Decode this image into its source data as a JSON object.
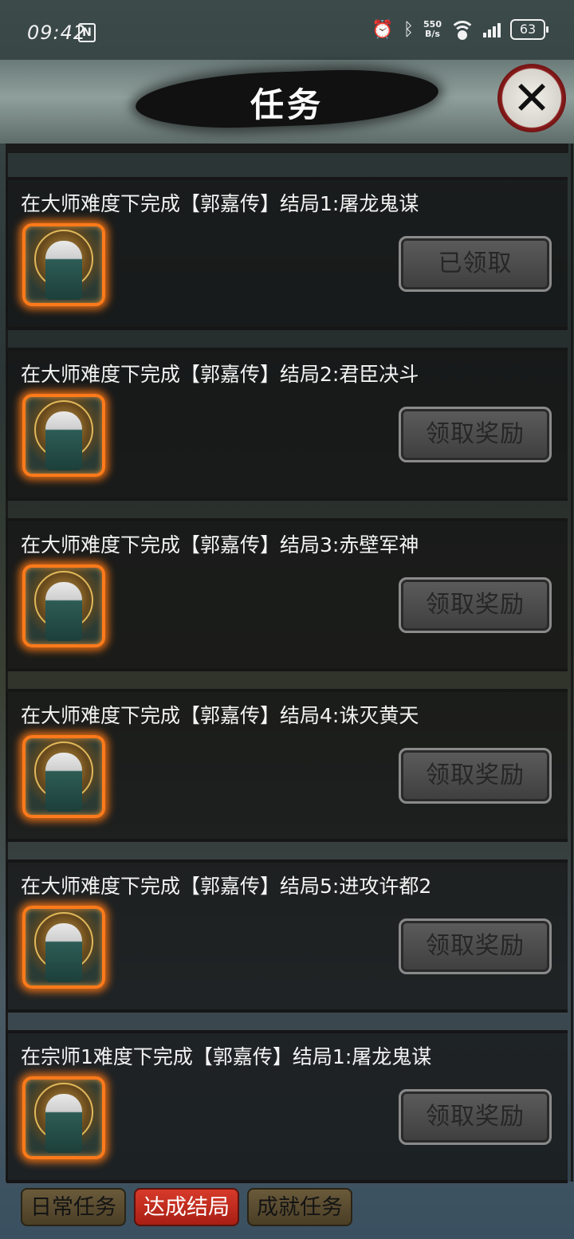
{
  "status_bar": {
    "time": "09:42",
    "nfc": "N",
    "net_speed_value": "550",
    "net_speed_unit": "B/s",
    "battery": "63"
  },
  "header": {
    "title": "任务",
    "close_icon": "close-icon"
  },
  "tasks": [
    {
      "title": "在大师难度下完成【郭嘉传】结局1:屠龙鬼谋",
      "button": "已领取"
    },
    {
      "title": "在大师难度下完成【郭嘉传】结局2:君臣决斗",
      "button": "领取奖励"
    },
    {
      "title": "在大师难度下完成【郭嘉传】结局3:赤壁军神",
      "button": "领取奖励"
    },
    {
      "title": "在大师难度下完成【郭嘉传】结局4:诛灭黄天",
      "button": "领取奖励"
    },
    {
      "title": "在大师难度下完成【郭嘉传】结局5:进攻许都2",
      "button": "领取奖励"
    },
    {
      "title": "在宗师1难度下完成【郭嘉传】结局1:屠龙鬼谋",
      "button": "领取奖励"
    }
  ],
  "tabs": [
    {
      "label": "日常任务",
      "active": false
    },
    {
      "label": "达成结局",
      "active": true
    },
    {
      "label": "成就任务",
      "active": false
    }
  ],
  "colors": {
    "active_tab": "#d73a2a",
    "reward_glow": "#ff7a1a"
  }
}
